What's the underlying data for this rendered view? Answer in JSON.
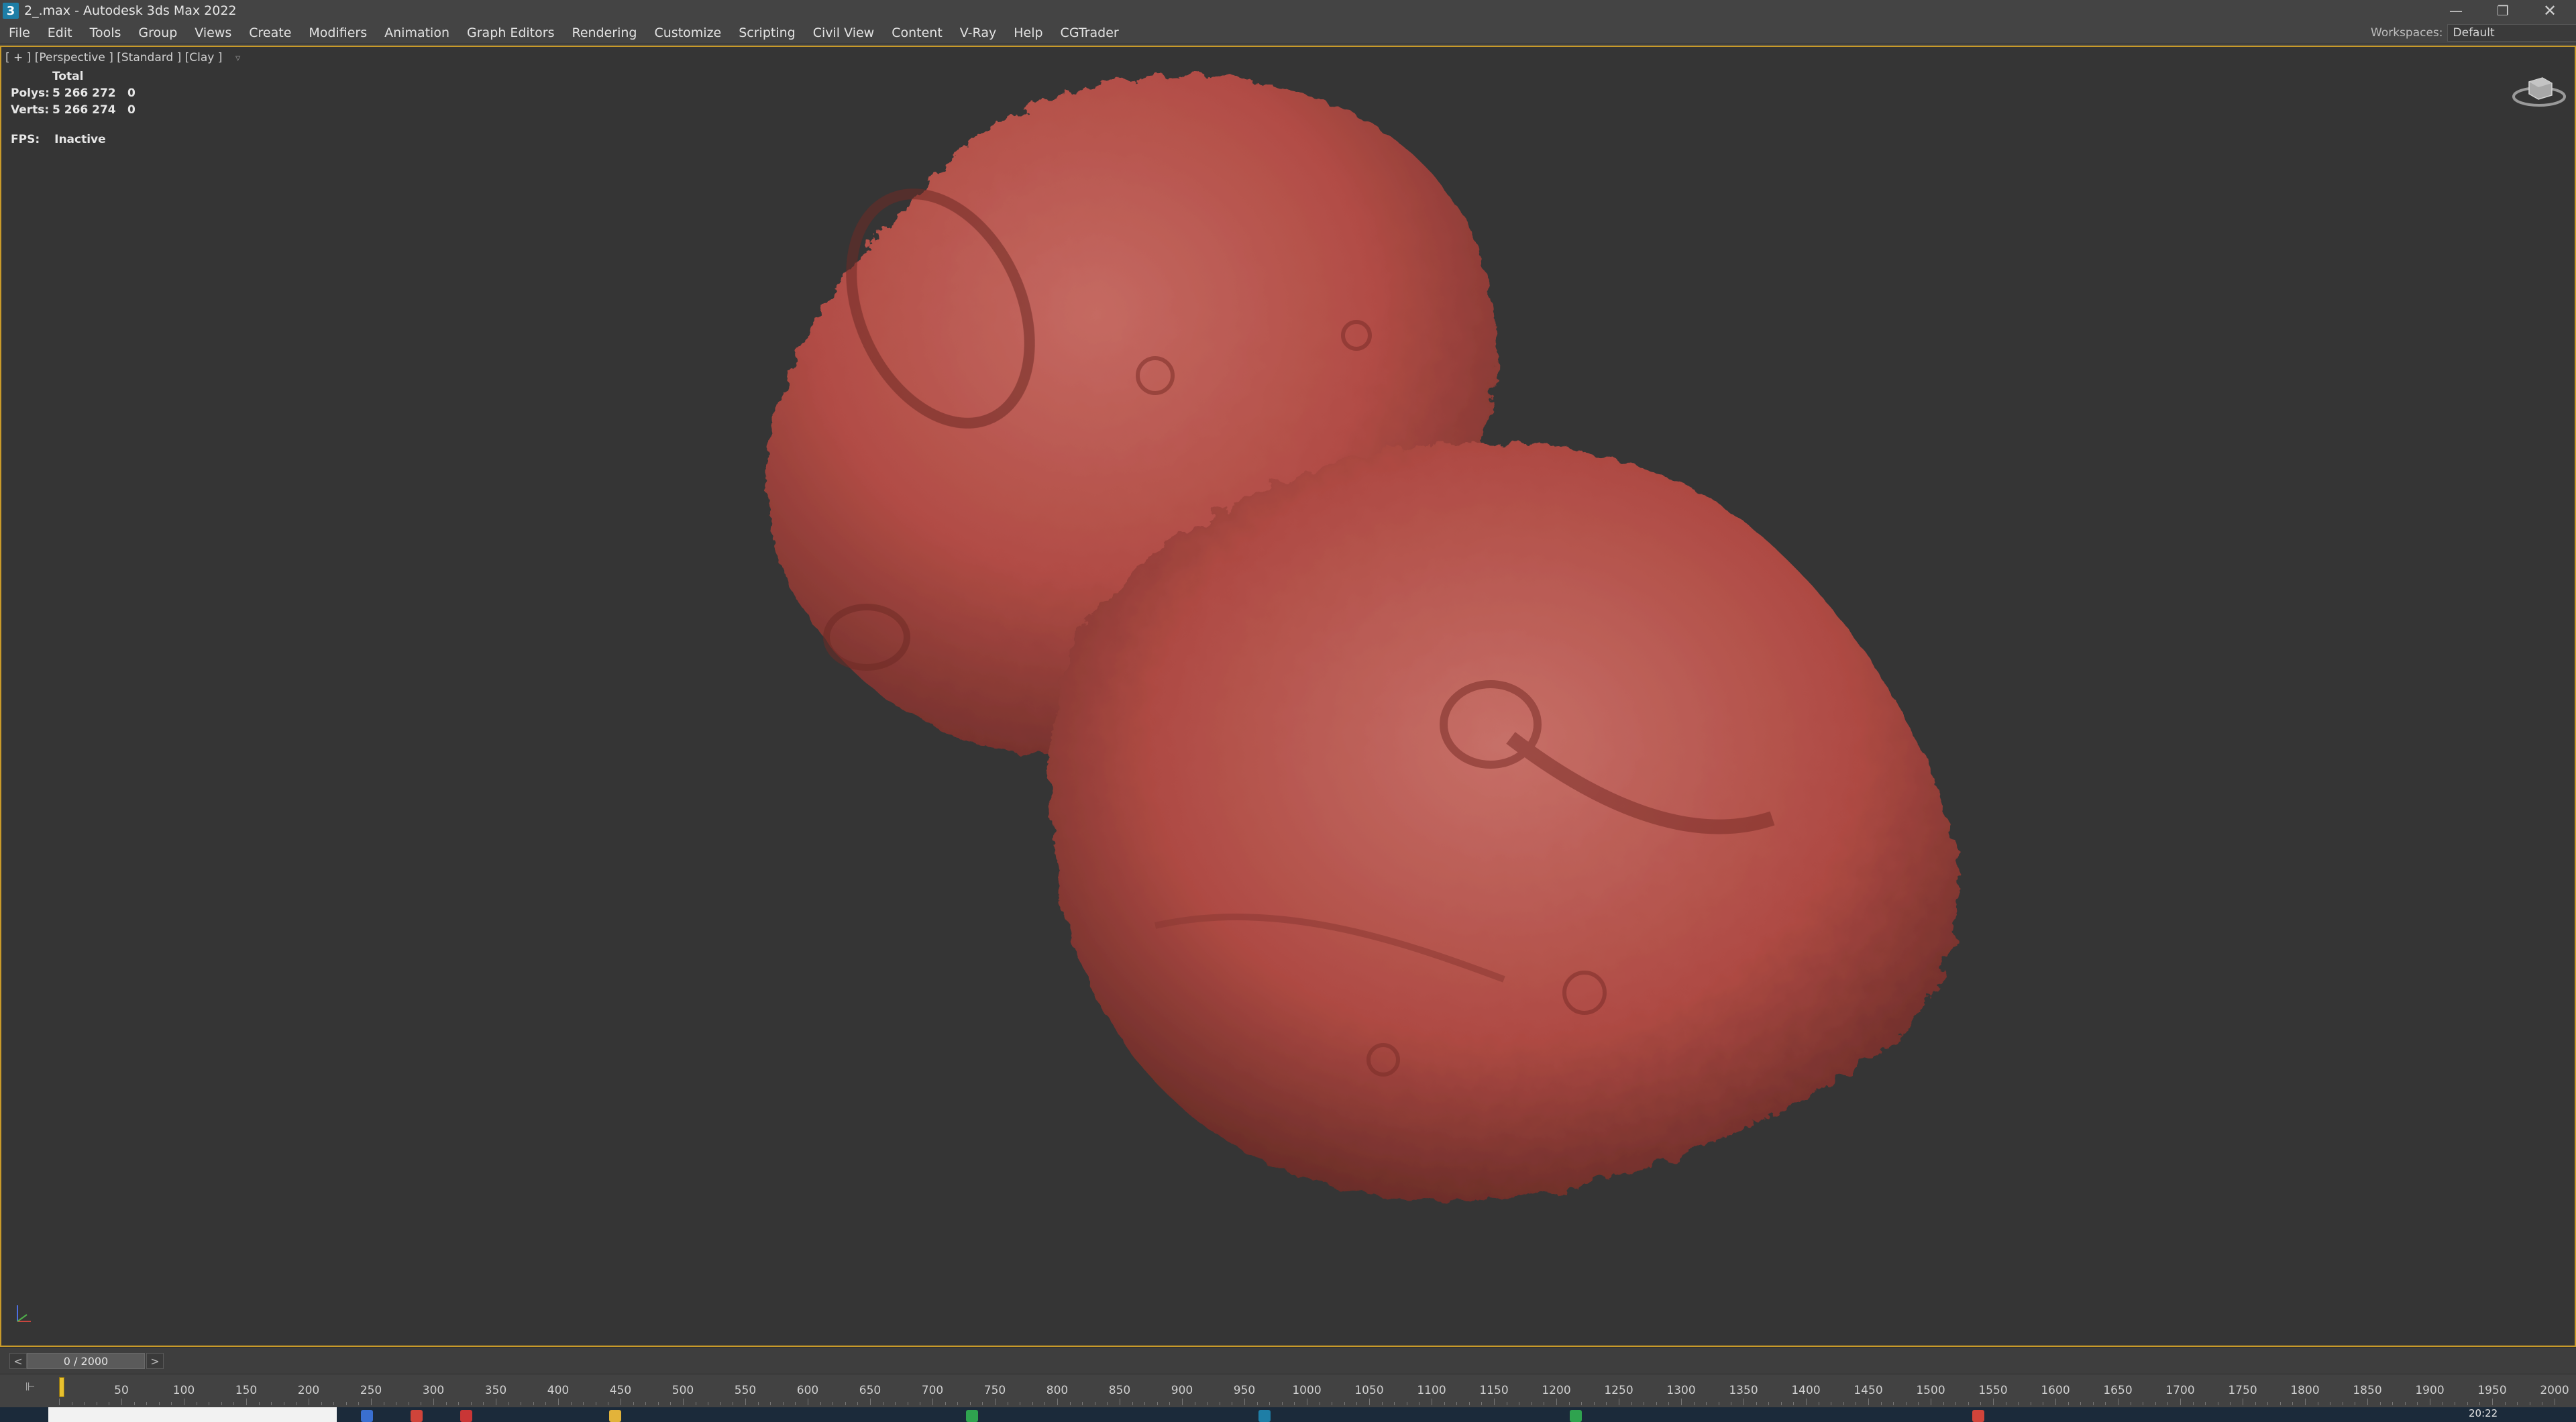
{
  "window": {
    "title": "2_.max - Autodesk 3ds Max 2022",
    "app_icon_label": "3",
    "controls": {
      "minimize": "—",
      "maximize": "❐",
      "close": "✕"
    }
  },
  "menu": {
    "items": [
      "File",
      "Edit",
      "Tools",
      "Group",
      "Views",
      "Create",
      "Modifiers",
      "Animation",
      "Graph Editors",
      "Rendering",
      "Customize",
      "Scripting",
      "Civil View",
      "Content",
      "V-Ray",
      "Help",
      "CGTrader"
    ],
    "workspaces_label": "Workspaces:",
    "workspaces_value": "Default"
  },
  "viewport": {
    "label": "[ + ] [Perspective ] [Standard ] [Clay ]",
    "filter_icon": "funnel-icon",
    "stats": {
      "header": "Total",
      "polys_label": "Polys:",
      "polys_value": "5 266 272",
      "polys_sel": "0",
      "verts_label": "Verts:",
      "verts_value": "5 266 274",
      "verts_sel": "0"
    },
    "fps_label": "FPS:",
    "fps_value": "Inactive",
    "object_color": "#b9504a"
  },
  "timeline": {
    "prev": "<",
    "frame_display": "0 / 2000",
    "next": ">",
    "toggle_label": "⊩",
    "ticks": [
      "50",
      "100",
      "150",
      "200",
      "250",
      "300",
      "350",
      "400",
      "450",
      "500",
      "550",
      "600",
      "650",
      "700",
      "750",
      "800",
      "850",
      "900",
      "950",
      "1000",
      "1050",
      "1100",
      "1150",
      "1200",
      "1250",
      "1300",
      "1350",
      "1400",
      "1450",
      "1500",
      "1550",
      "1600",
      "1650",
      "1700",
      "1750",
      "1800",
      "1850",
      "1900",
      "1950",
      "2000"
    ],
    "playhead_frame": 0,
    "total_frames": 2000
  },
  "taskbar": {
    "clock": "20:22"
  }
}
